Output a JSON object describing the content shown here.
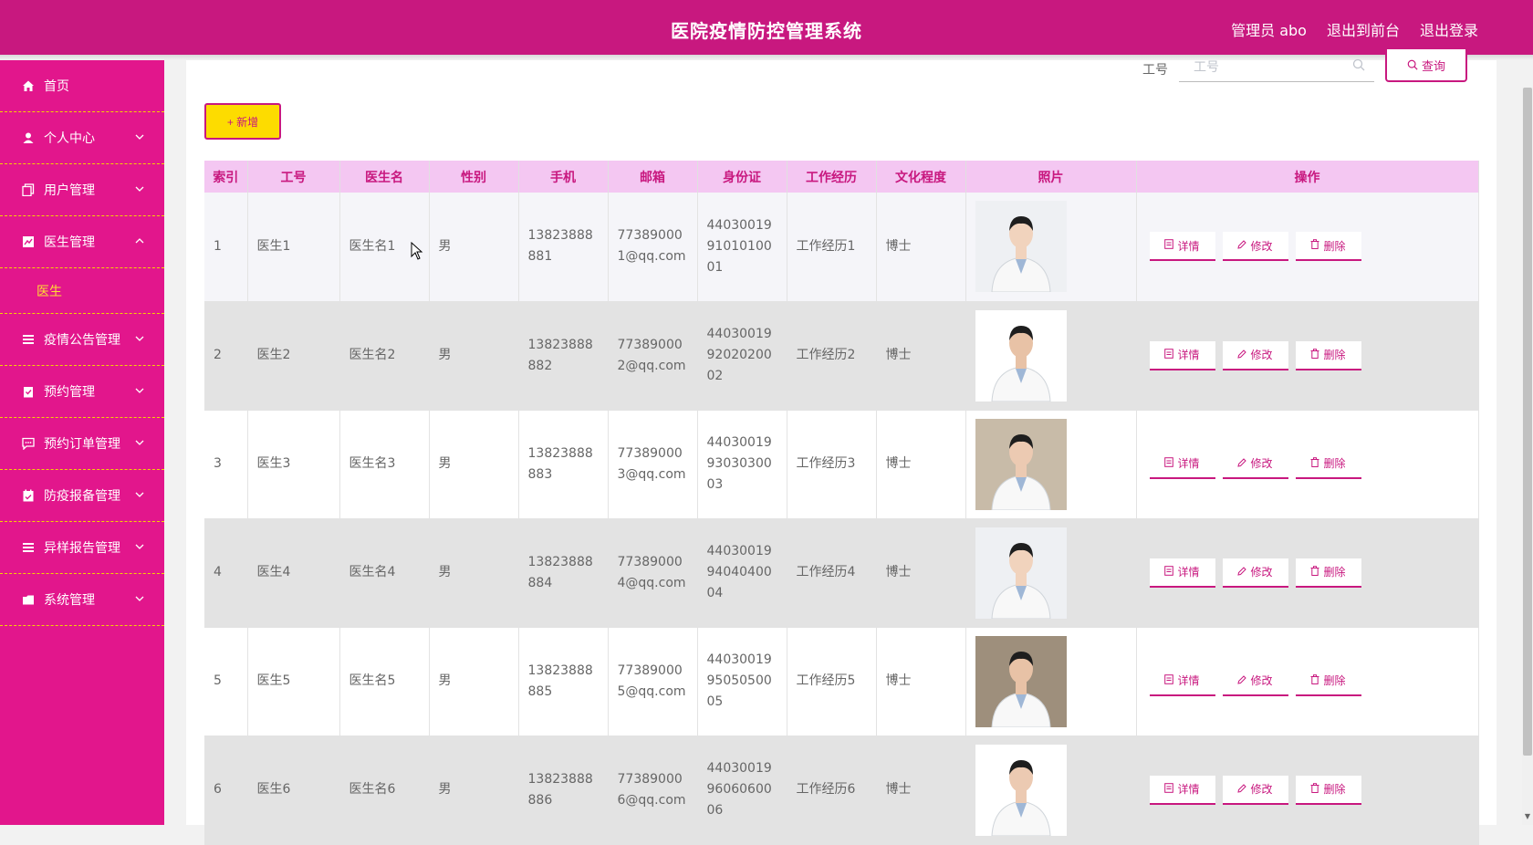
{
  "header": {
    "title": "医院疫情防控管理系统",
    "admin": "管理员 abo",
    "to_front": "退出到前台",
    "logout": "退出登录"
  },
  "sidebar": {
    "items": [
      {
        "label": "首页",
        "icon": "home-icon",
        "expandable": false
      },
      {
        "label": "个人中心",
        "icon": "user-icon",
        "expandable": true
      },
      {
        "label": "用户管理",
        "icon": "copy-icon",
        "expandable": true
      },
      {
        "label": "医生管理",
        "icon": "chart-icon",
        "expandable": true,
        "expanded": true,
        "children": [
          "医生"
        ]
      },
      {
        "label": "疫情公告管理",
        "icon": "list-icon",
        "expandable": true
      },
      {
        "label": "预约管理",
        "icon": "clipboard-icon",
        "expandable": true
      },
      {
        "label": "预约订单管理",
        "icon": "chat-icon",
        "expandable": true
      },
      {
        "label": "防疫报备管理",
        "icon": "calendar-icon",
        "expandable": true
      },
      {
        "label": "异样报告管理",
        "icon": "list-icon",
        "expandable": true
      },
      {
        "label": "系统管理",
        "icon": "folder-icon",
        "expandable": true
      }
    ]
  },
  "search": {
    "label": "工号",
    "placeholder": "工号",
    "button": "查询"
  },
  "toolbar": {
    "add_label": "+ 新增"
  },
  "table": {
    "columns": [
      "索引",
      "工号",
      "医生名",
      "性别",
      "手机",
      "邮箱",
      "身份证",
      "工作经历",
      "文化程度",
      "照片",
      "操作"
    ],
    "rows": [
      {
        "index": "1",
        "id": "医生1",
        "name": "医生名1",
        "gender": "男",
        "phone": "13823888881",
        "email": "773890001@qq.com",
        "idcard": "440300199101010001",
        "experience": "工作经历1",
        "education": "博士"
      },
      {
        "index": "2",
        "id": "医生2",
        "name": "医生名2",
        "gender": "男",
        "phone": "13823888882",
        "email": "773890002@qq.com",
        "idcard": "440300199202020002",
        "experience": "工作经历2",
        "education": "博士"
      },
      {
        "index": "3",
        "id": "医生3",
        "name": "医生名3",
        "gender": "男",
        "phone": "13823888883",
        "email": "773890003@qq.com",
        "idcard": "440300199303030003",
        "experience": "工作经历3",
        "education": "博士"
      },
      {
        "index": "4",
        "id": "医生4",
        "name": "医生名4",
        "gender": "男",
        "phone": "13823888884",
        "email": "773890004@qq.com",
        "idcard": "440300199404040004",
        "experience": "工作经历4",
        "education": "博士"
      },
      {
        "index": "5",
        "id": "医生5",
        "name": "医生名5",
        "gender": "男",
        "phone": "13823888885",
        "email": "773890005@qq.com",
        "idcard": "440300199505050005",
        "experience": "工作经历5",
        "education": "博士"
      },
      {
        "index": "6",
        "id": "医生6",
        "name": "医生名6",
        "gender": "男",
        "phone": "13823888886",
        "email": "773890006@qq.com",
        "idcard": "440300199606060006",
        "experience": "工作经历6",
        "education": "博士"
      }
    ],
    "actions": {
      "detail": "详情",
      "edit": "修改",
      "delete": "删除"
    }
  },
  "colors": {
    "header": "#c8187f",
    "sidebar": "#e2168c",
    "accent_yellow": "#fddc00",
    "table_header": "#f4c7f2"
  }
}
